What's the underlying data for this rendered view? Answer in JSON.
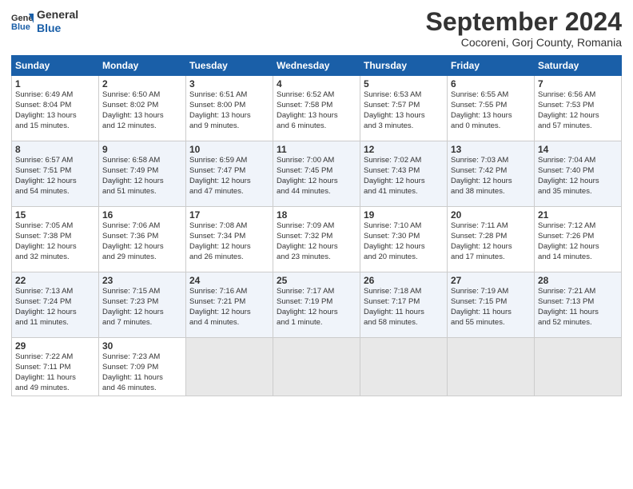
{
  "logo": {
    "line1": "General",
    "line2": "Blue"
  },
  "title": "September 2024",
  "subtitle": "Cocoreni, Gorj County, Romania",
  "days_of_week": [
    "Sunday",
    "Monday",
    "Tuesday",
    "Wednesday",
    "Thursday",
    "Friday",
    "Saturday"
  ],
  "weeks": [
    [
      {
        "day": "1",
        "info": "Sunrise: 6:49 AM\nSunset: 8:04 PM\nDaylight: 13 hours\nand 15 minutes."
      },
      {
        "day": "2",
        "info": "Sunrise: 6:50 AM\nSunset: 8:02 PM\nDaylight: 13 hours\nand 12 minutes."
      },
      {
        "day": "3",
        "info": "Sunrise: 6:51 AM\nSunset: 8:00 PM\nDaylight: 13 hours\nand 9 minutes."
      },
      {
        "day": "4",
        "info": "Sunrise: 6:52 AM\nSunset: 7:58 PM\nDaylight: 13 hours\nand 6 minutes."
      },
      {
        "day": "5",
        "info": "Sunrise: 6:53 AM\nSunset: 7:57 PM\nDaylight: 13 hours\nand 3 minutes."
      },
      {
        "day": "6",
        "info": "Sunrise: 6:55 AM\nSunset: 7:55 PM\nDaylight: 13 hours\nand 0 minutes."
      },
      {
        "day": "7",
        "info": "Sunrise: 6:56 AM\nSunset: 7:53 PM\nDaylight: 12 hours\nand 57 minutes."
      }
    ],
    [
      {
        "day": "8",
        "info": "Sunrise: 6:57 AM\nSunset: 7:51 PM\nDaylight: 12 hours\nand 54 minutes."
      },
      {
        "day": "9",
        "info": "Sunrise: 6:58 AM\nSunset: 7:49 PM\nDaylight: 12 hours\nand 51 minutes."
      },
      {
        "day": "10",
        "info": "Sunrise: 6:59 AM\nSunset: 7:47 PM\nDaylight: 12 hours\nand 47 minutes."
      },
      {
        "day": "11",
        "info": "Sunrise: 7:00 AM\nSunset: 7:45 PM\nDaylight: 12 hours\nand 44 minutes."
      },
      {
        "day": "12",
        "info": "Sunrise: 7:02 AM\nSunset: 7:43 PM\nDaylight: 12 hours\nand 41 minutes."
      },
      {
        "day": "13",
        "info": "Sunrise: 7:03 AM\nSunset: 7:42 PM\nDaylight: 12 hours\nand 38 minutes."
      },
      {
        "day": "14",
        "info": "Sunrise: 7:04 AM\nSunset: 7:40 PM\nDaylight: 12 hours\nand 35 minutes."
      }
    ],
    [
      {
        "day": "15",
        "info": "Sunrise: 7:05 AM\nSunset: 7:38 PM\nDaylight: 12 hours\nand 32 minutes."
      },
      {
        "day": "16",
        "info": "Sunrise: 7:06 AM\nSunset: 7:36 PM\nDaylight: 12 hours\nand 29 minutes."
      },
      {
        "day": "17",
        "info": "Sunrise: 7:08 AM\nSunset: 7:34 PM\nDaylight: 12 hours\nand 26 minutes."
      },
      {
        "day": "18",
        "info": "Sunrise: 7:09 AM\nSunset: 7:32 PM\nDaylight: 12 hours\nand 23 minutes."
      },
      {
        "day": "19",
        "info": "Sunrise: 7:10 AM\nSunset: 7:30 PM\nDaylight: 12 hours\nand 20 minutes."
      },
      {
        "day": "20",
        "info": "Sunrise: 7:11 AM\nSunset: 7:28 PM\nDaylight: 12 hours\nand 17 minutes."
      },
      {
        "day": "21",
        "info": "Sunrise: 7:12 AM\nSunset: 7:26 PM\nDaylight: 12 hours\nand 14 minutes."
      }
    ],
    [
      {
        "day": "22",
        "info": "Sunrise: 7:13 AM\nSunset: 7:24 PM\nDaylight: 12 hours\nand 11 minutes."
      },
      {
        "day": "23",
        "info": "Sunrise: 7:15 AM\nSunset: 7:23 PM\nDaylight: 12 hours\nand 7 minutes."
      },
      {
        "day": "24",
        "info": "Sunrise: 7:16 AM\nSunset: 7:21 PM\nDaylight: 12 hours\nand 4 minutes."
      },
      {
        "day": "25",
        "info": "Sunrise: 7:17 AM\nSunset: 7:19 PM\nDaylight: 12 hours\nand 1 minute."
      },
      {
        "day": "26",
        "info": "Sunrise: 7:18 AM\nSunset: 7:17 PM\nDaylight: 11 hours\nand 58 minutes."
      },
      {
        "day": "27",
        "info": "Sunrise: 7:19 AM\nSunset: 7:15 PM\nDaylight: 11 hours\nand 55 minutes."
      },
      {
        "day": "28",
        "info": "Sunrise: 7:21 AM\nSunset: 7:13 PM\nDaylight: 11 hours\nand 52 minutes."
      }
    ],
    [
      {
        "day": "29",
        "info": "Sunrise: 7:22 AM\nSunset: 7:11 PM\nDaylight: 11 hours\nand 49 minutes."
      },
      {
        "day": "30",
        "info": "Sunrise: 7:23 AM\nSunset: 7:09 PM\nDaylight: 11 hours\nand 46 minutes."
      },
      {
        "day": "",
        "info": ""
      },
      {
        "day": "",
        "info": ""
      },
      {
        "day": "",
        "info": ""
      },
      {
        "day": "",
        "info": ""
      },
      {
        "day": "",
        "info": ""
      }
    ]
  ]
}
